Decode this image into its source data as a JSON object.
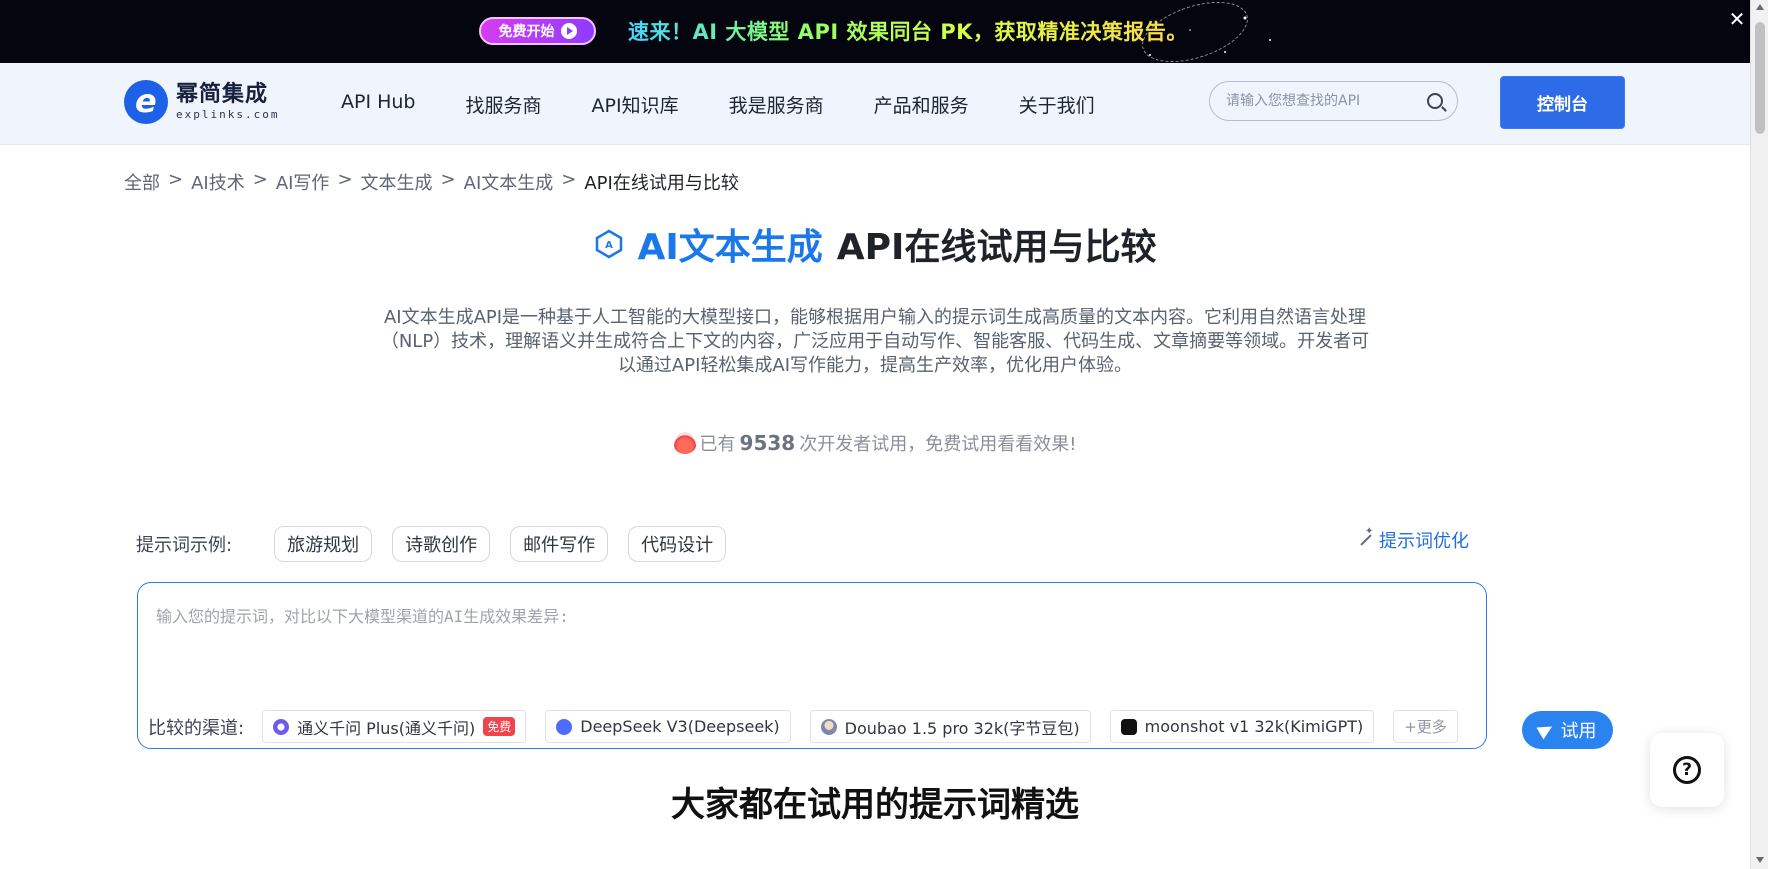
{
  "promo": {
    "button_label": "免费开始",
    "text": "速来！AI 大模型 API 效果同台 PK，获取精准决策报告。",
    "close_symbol": "✕"
  },
  "header": {
    "logo_cn": "幂简集成",
    "logo_en": "explinks.com",
    "nav": [
      "API Hub",
      "找服务商",
      "API知识库",
      "我是服务商",
      "产品和服务",
      "关于我们"
    ],
    "search_placeholder": "请输入您想查找的API",
    "console_label": "控制台"
  },
  "breadcrumb": {
    "items": [
      "全部",
      "AI技术",
      "AI写作",
      "文本生成",
      "AI文本生成"
    ],
    "current": "API在线试用与比较",
    "separator": ">"
  },
  "hero": {
    "title_highlight": "AI文本生成",
    "title_rest": "API在线试用与比较",
    "description": "AI文本生成API是一种基于人工智能的大模型接口，能够根据用户输入的提示词生成高质量的文本内容。它利用自然语言处理（NLP）技术，理解语义并生成符合上下文的内容，广泛应用于自动写作、智能客服、代码生成、文章摘要等领域。开发者可以通过API轻松集成AI写作能力，提高生产效率，优化用户体验。",
    "tried_prefix": "已有",
    "tried_count": "9538",
    "tried_suffix": "次开发者试用，免费试用看看效果!"
  },
  "prompt": {
    "examples_label": "提示词示例:",
    "examples": [
      "旅游规划",
      "诗歌创作",
      "邮件写作",
      "代码设计"
    ],
    "optimize_label": "提示词优化",
    "placeholder": "输入您的提示词，对比以下大模型渠道的AI生成效果差异:",
    "channels_label": "比较的渠道:",
    "channels": [
      {
        "name": "通义千问 Plus(通义千问)",
        "badge": "免费",
        "color": "#6a5cf0"
      },
      {
        "name": "DeepSeek V3(Deepseek)",
        "badge": "",
        "color": "#4d6bfe"
      },
      {
        "name": "Doubao 1.5 pro 32k(字节豆包)",
        "badge": "",
        "color": "#7a8aa8"
      },
      {
        "name": "moonshot v1 32k(KimiGPT)",
        "badge": "",
        "color": "#111111"
      }
    ],
    "more_label": "+更多",
    "try_label": "试用"
  },
  "section": {
    "title": "大家都在试用的提示词精选"
  }
}
